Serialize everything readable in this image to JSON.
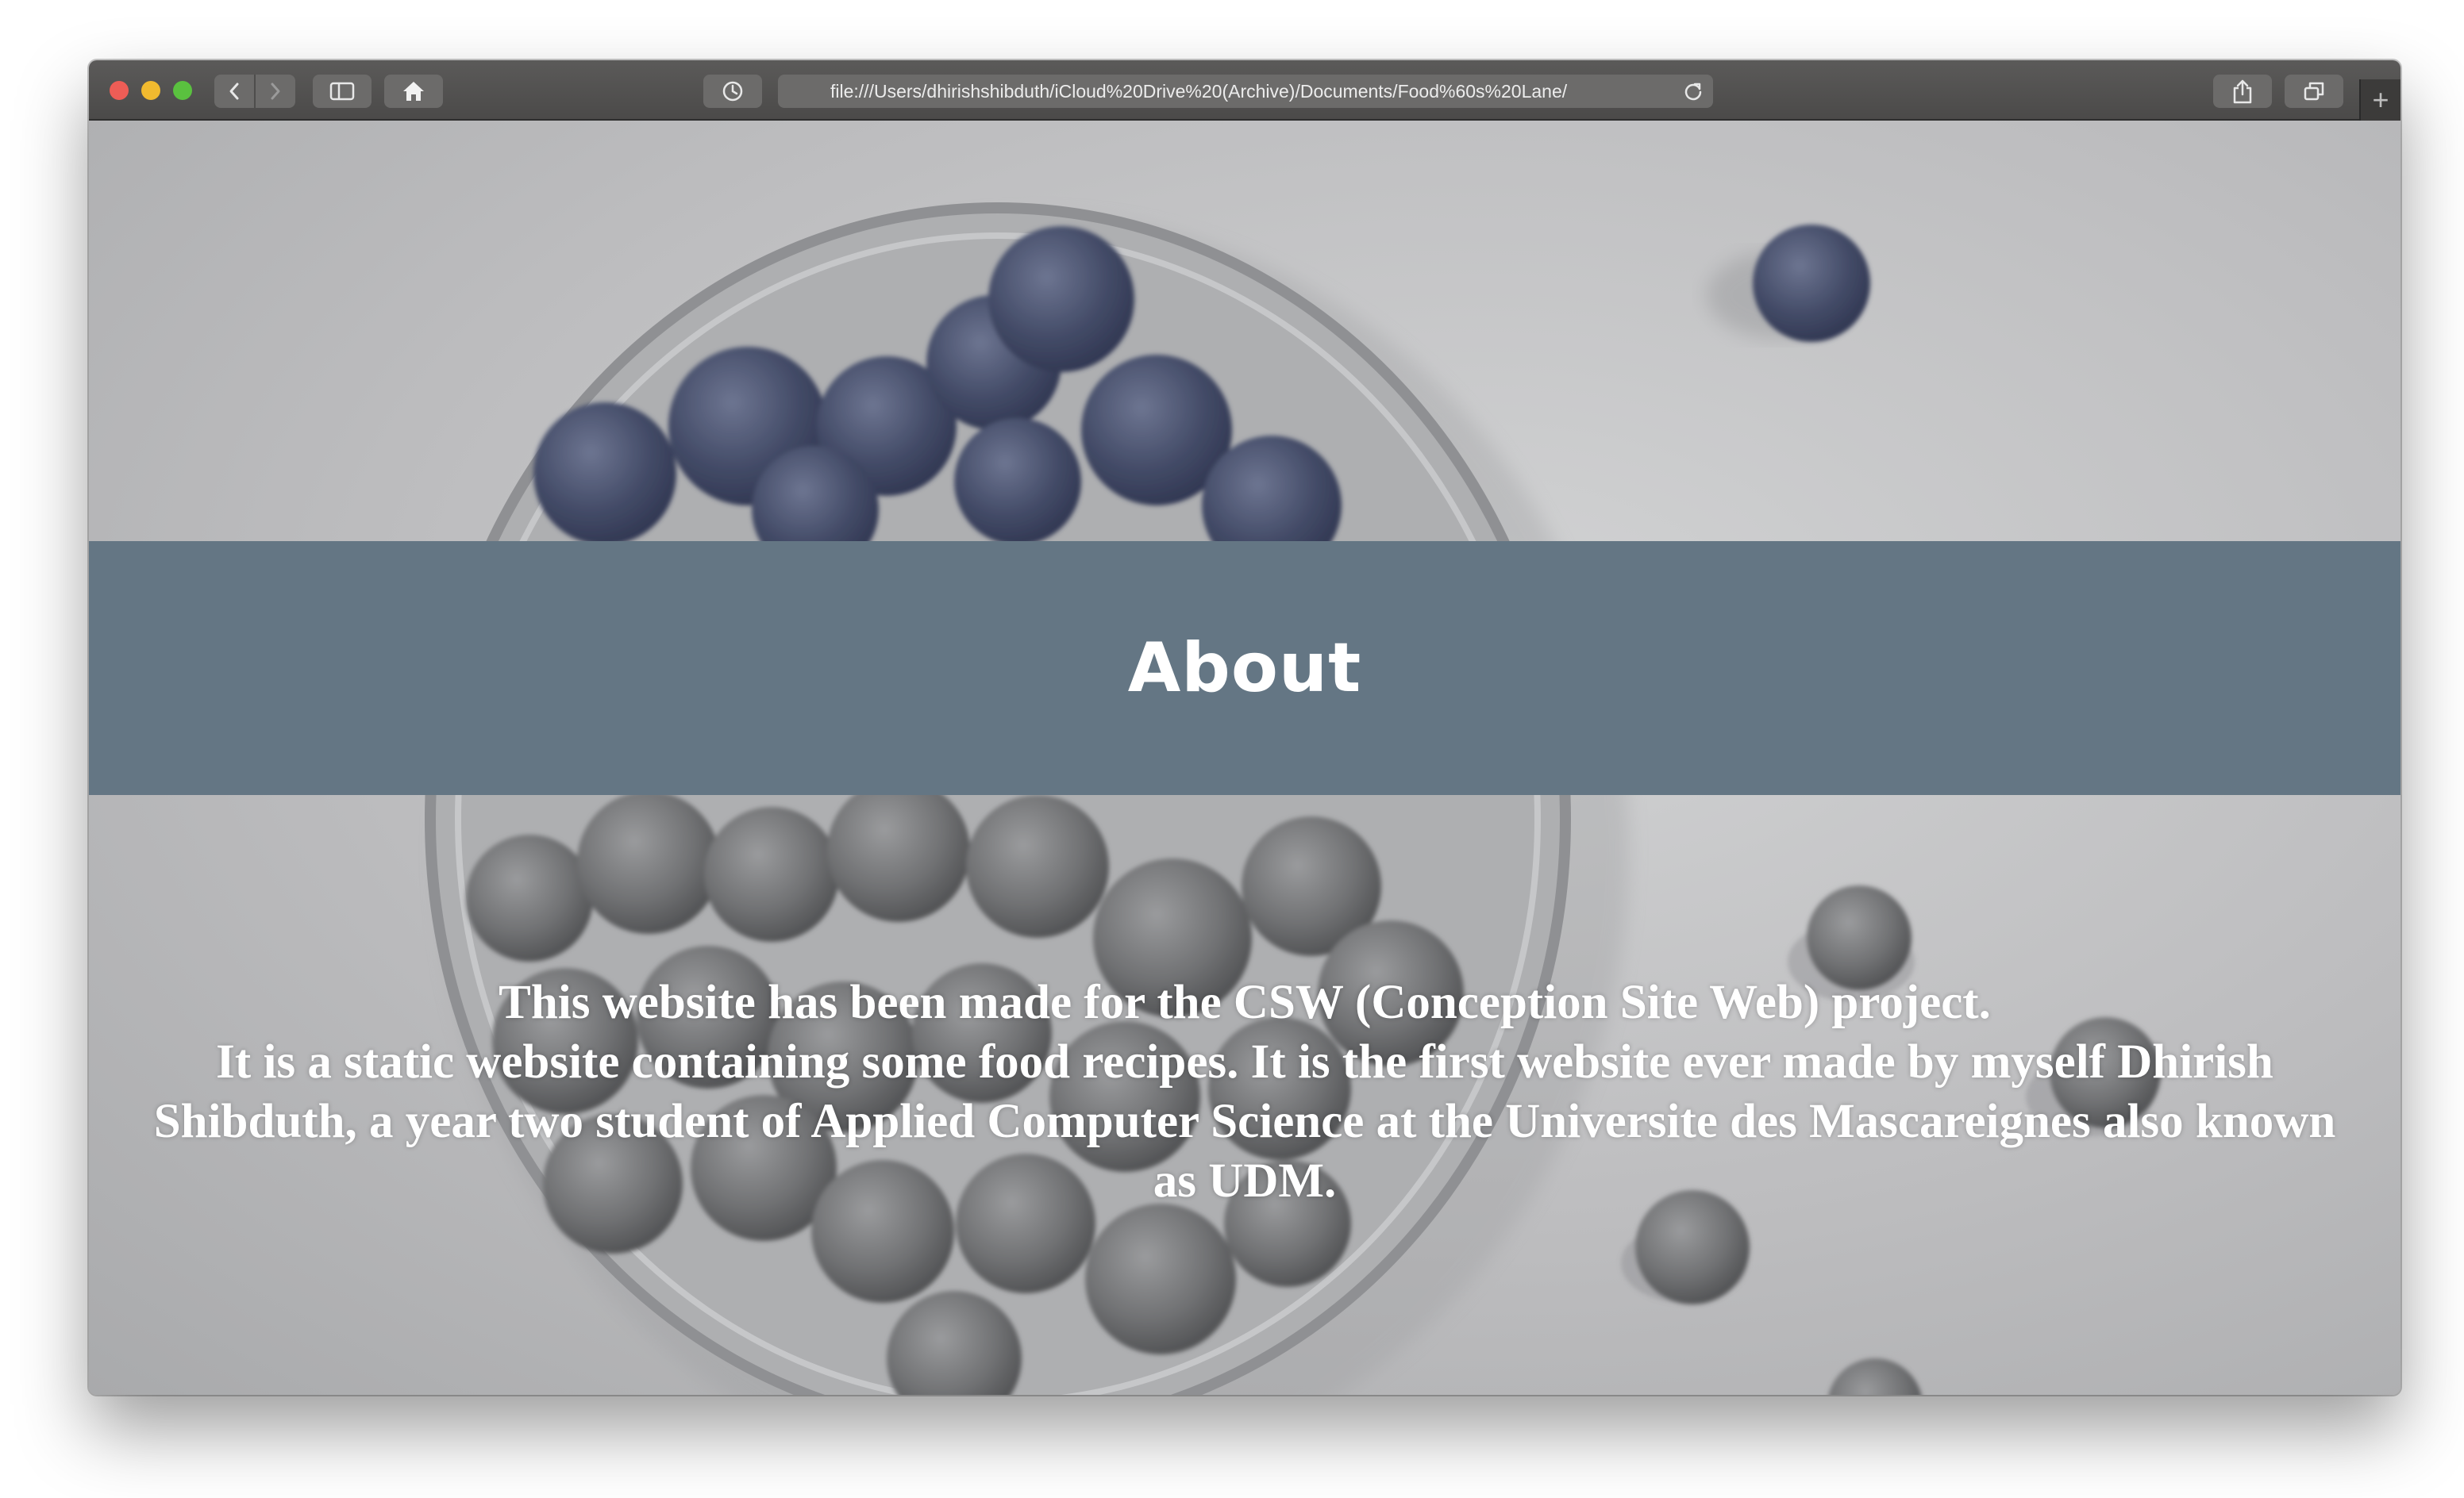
{
  "browser": {
    "url": "file:///Users/dhirishshibduth/iCloud%20Drive%20(Archive)/Documents/Food%60s%20Lane/",
    "new_tab_symbol": "+",
    "icons": [
      "back-icon",
      "forward-icon",
      "sidebar-icon",
      "home-icon",
      "history-icon",
      "reload-icon",
      "share-icon",
      "tabs-icon"
    ]
  },
  "page": {
    "heading": "About",
    "paragraph_1": "This website has been made for the CSW (Conception Site Web) project.",
    "paragraph_2": "It is a static website containing some food recipes. It is the first website ever made by myself Dhirish Shibduth, a year two student of Applied Computer Science at the Universite des Mascareignes also known as UDM."
  },
  "colors": {
    "banner": "#647684",
    "toolbar": "#4f4e4d",
    "text": "#ffffff"
  }
}
